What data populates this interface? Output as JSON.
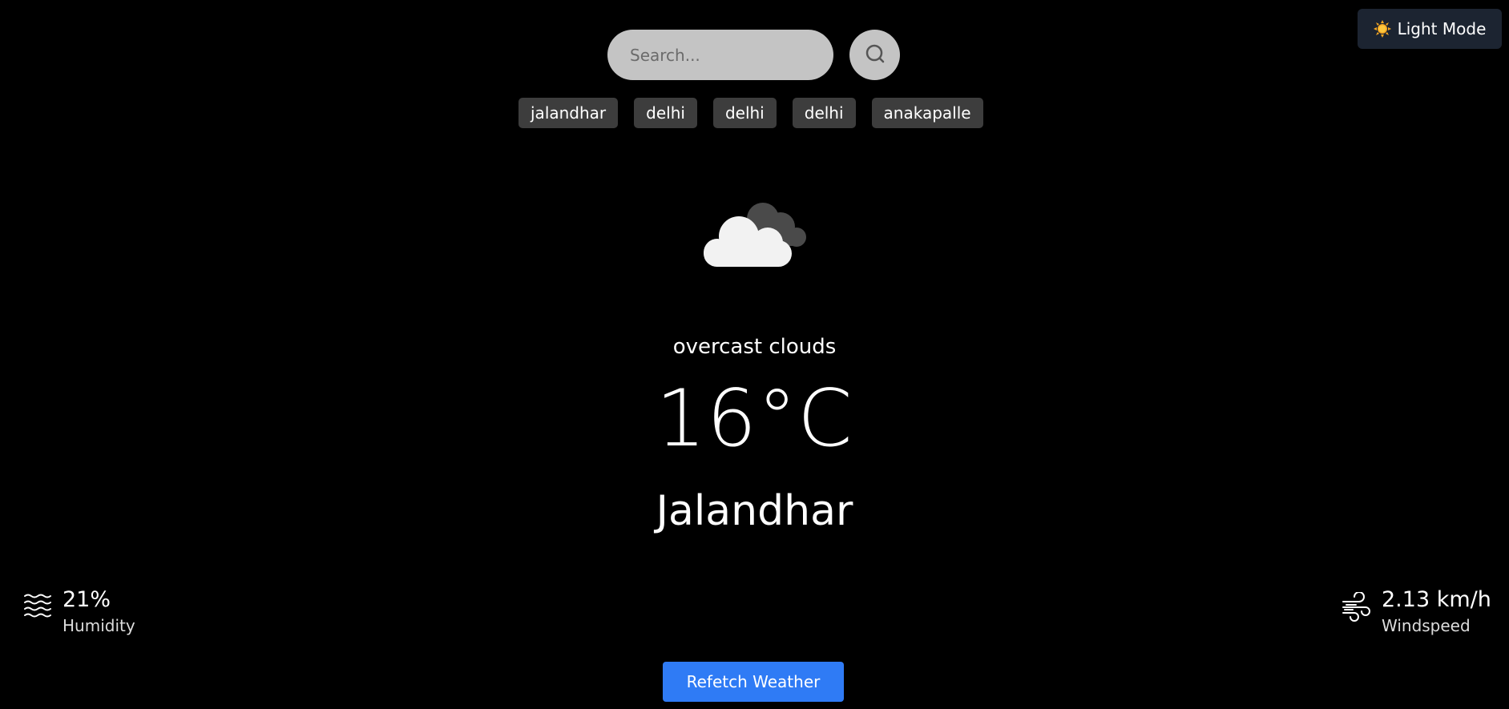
{
  "theme_toggle": {
    "label": "Light Mode",
    "icon": "sun-icon"
  },
  "search": {
    "placeholder": "Search...",
    "value": "",
    "button_icon": "search-icon"
  },
  "history": [
    "jalandhar",
    "delhi",
    "delhi",
    "delhi",
    "anakapalle"
  ],
  "weather": {
    "icon": "cloud-icon",
    "description": "overcast clouds",
    "temperature": "16°C",
    "city": "Jalandhar"
  },
  "humidity": {
    "value": "21%",
    "label": "Humidity",
    "icon": "humidity-icon"
  },
  "wind": {
    "value": "2.13 km/h",
    "label": "Windspeed",
    "icon": "wind-icon"
  },
  "refetch": {
    "label": "Refetch Weather"
  },
  "colors": {
    "background": "#000000",
    "chip": "#3d3d3d",
    "search": "#c4c4c4",
    "toggle": "#1c2431",
    "accent": "#2f7bf5"
  }
}
